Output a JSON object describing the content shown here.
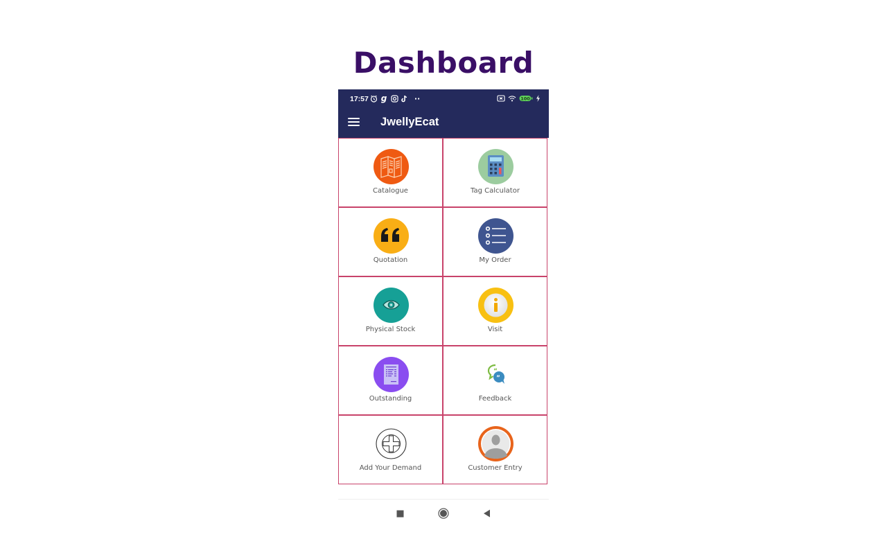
{
  "page": {
    "title": "Dashboard"
  },
  "status_bar": {
    "time": "17:57",
    "left_icons": [
      "alarm-icon",
      "g-app-icon",
      "instagram-icon",
      "tiktok-icon",
      "more-dots-icon"
    ],
    "right_icons": [
      "sim-off-icon",
      "wifi-icon",
      "battery-icon",
      "charging-icon"
    ],
    "battery_level": "100"
  },
  "app_bar": {
    "title": "JwellyEcat",
    "menu_icon": "hamburger-menu-icon"
  },
  "dashboard": {
    "items": [
      {
        "label": "Catalogue",
        "icon": "catalogue-icon",
        "color": "#ef5a12"
      },
      {
        "label": "Tag Calculator",
        "icon": "calculator-icon",
        "color": "#9ccc9f"
      },
      {
        "label": "Quotation",
        "icon": "quote-icon",
        "color": "#f9ae15"
      },
      {
        "label": "My Order",
        "icon": "list-icon",
        "color": "#3f5590"
      },
      {
        "label": "Physical Stock",
        "icon": "eye-icon",
        "color": "#16a096"
      },
      {
        "label": "Visit",
        "icon": "info-icon",
        "color": "#f8c012"
      },
      {
        "label": "Outstanding",
        "icon": "document-icon",
        "color": "#8a4df0"
      },
      {
        "label": "Feedback",
        "icon": "chat-bubbles-icon",
        "color": "#7dbb42"
      },
      {
        "label": "Add Your Demand",
        "icon": "add-circle-icon",
        "color": "#333333"
      },
      {
        "label": "Customer Entry",
        "icon": "user-avatar-icon",
        "color": "#e8641c"
      }
    ]
  },
  "nav_bar": {
    "recents": "recents-button",
    "home": "home-button",
    "back": "back-button"
  },
  "colors": {
    "app_bar": "#242a5c",
    "title": "#3a0f66",
    "grid_border": "#c8426a"
  }
}
